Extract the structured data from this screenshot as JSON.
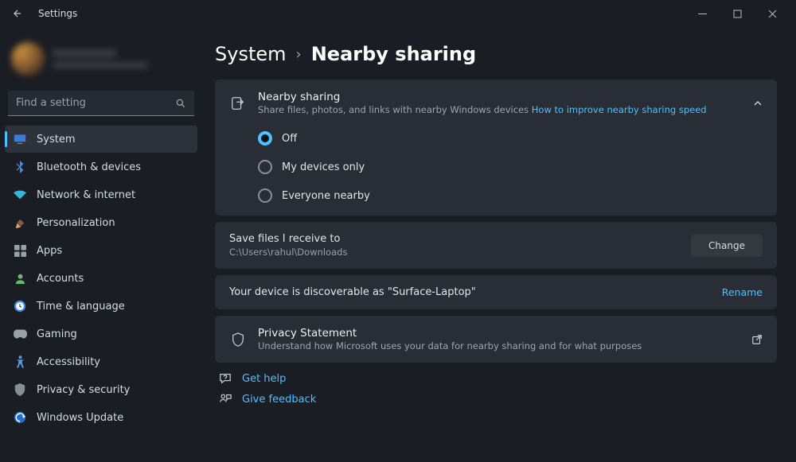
{
  "window": {
    "title": "Settings"
  },
  "search": {
    "placeholder": "Find a setting"
  },
  "sidebar": {
    "items": [
      {
        "label": "System"
      },
      {
        "label": "Bluetooth & devices"
      },
      {
        "label": "Network & internet"
      },
      {
        "label": "Personalization"
      },
      {
        "label": "Apps"
      },
      {
        "label": "Accounts"
      },
      {
        "label": "Time & language"
      },
      {
        "label": "Gaming"
      },
      {
        "label": "Accessibility"
      },
      {
        "label": "Privacy & security"
      },
      {
        "label": "Windows Update"
      }
    ]
  },
  "breadcrumb": {
    "root": "System",
    "page": "Nearby sharing"
  },
  "nearby": {
    "title": "Nearby sharing",
    "subtitle_a": "Share files, photos, and links with nearby Windows devices",
    "subtitle_link": "How to improve nearby sharing speed",
    "options": {
      "off": "Off",
      "mine": "My devices only",
      "everyone": "Everyone nearby"
    }
  },
  "save": {
    "label": "Save files I receive to",
    "path": "C:\\Users\\rahul\\Downloads",
    "button": "Change"
  },
  "discover": {
    "text": "Your device is discoverable as \"Surface-Laptop\"",
    "button": "Rename"
  },
  "privacy": {
    "title": "Privacy Statement",
    "subtitle": "Understand how Microsoft uses your data for nearby sharing and for what purposes"
  },
  "help": {
    "get": "Get help",
    "feedback": "Give feedback"
  },
  "colors": {
    "accent": "#4cc2ff"
  }
}
